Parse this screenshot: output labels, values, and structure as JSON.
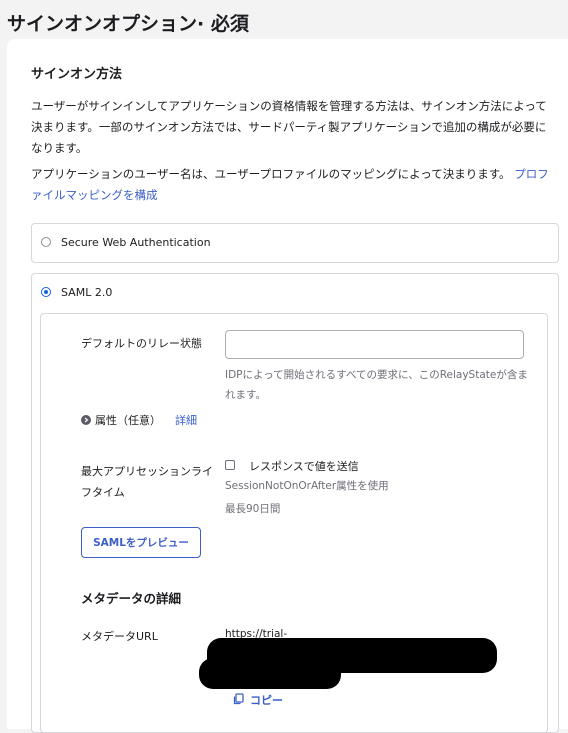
{
  "page_title": "サインオンオプション· 必須",
  "section": {
    "heading": "サインオン方法",
    "para1": "ユーザーがサインインしてアプリケーションの資格情報を管理する方法は、サインオン方法によって決まります。一部のサインオン方法では、サードパーティ製アプリケーションで追加の構成が必要になります。",
    "para2_text": "アプリケーションのユーザー名は、ユーザープロファイルのマッピングによって決まります。",
    "para2_link": "プロファイルマッピングを構成"
  },
  "options": {
    "swa_label": "Secure Web Authentication",
    "swa_selected": false,
    "saml_label": "SAML 2.0",
    "saml_selected": true
  },
  "saml": {
    "relay_label": "デフォルトのリレー状態",
    "relay_value": "",
    "relay_help": "IDPによって開始されるすべての要求に、このRelayStateが含まれます。",
    "attributes_label": "属性（任意）",
    "attributes_link": "詳細",
    "max_session_label": "最大アプリセッションライフタイム",
    "send_response_label": "レスポンスで値を送信",
    "send_response_checked": false,
    "session_attr_help": "SessionNotOnOrAfter属性を使用",
    "max_days_help": "最長90日間",
    "preview_button": "SAMLをプレビュー"
  },
  "metadata": {
    "heading": "メタデータの詳細",
    "url_label": "メタデータURL",
    "url_value": "https://trial-",
    "copy_label": "コピー"
  },
  "colors": {
    "link": "#3c5fc8",
    "radio_selected": "#1662dd",
    "border": "#d7d7dc"
  }
}
